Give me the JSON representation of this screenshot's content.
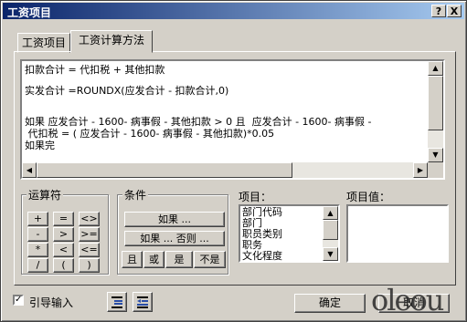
{
  "window": {
    "title": "工资项目",
    "help_glyph": "?",
    "close_glyph": "X"
  },
  "tabs": [
    {
      "label": "工资项目"
    },
    {
      "label": "工资计算方法"
    }
  ],
  "editor": {
    "lines": [
      "扣款合计 = 代扣税 + 其他扣款",
      "实发合计 =ROUNDX(应发合计 - 扣款合计,0)",
      "如果 应发合计 - 1600- 病事假 - 其他扣款 > 0 且  应发合计 - 1600- 病事假 -",
      " 代扣税 = ( 应发合计 - 1600- 病事假 - 其他扣款)*0.05",
      "如果完"
    ]
  },
  "operators": {
    "label": "运算符",
    "rows": [
      [
        "+",
        "=",
        "<>"
      ],
      [
        "-",
        ">",
        ">="
      ],
      [
        "*",
        "<",
        "<="
      ],
      [
        "/",
        "(",
        ")"
      ]
    ]
  },
  "conditions": {
    "label": "条件",
    "if_label": "如果 ...",
    "if_else_label": "如果 ... 否则 ...",
    "logic": [
      "且",
      "或",
      "是",
      "不是"
    ]
  },
  "items": {
    "label": "项目：",
    "list": [
      "部门代码",
      "部门",
      "职员类别",
      "职务",
      "文化程度"
    ]
  },
  "item_values": {
    "label": "项目值："
  },
  "footer": {
    "guide_input_label": "引导输入",
    "guide_input_checked": true,
    "ok_label": "确定",
    "cancel_label": "取消"
  },
  "watermark": "oleou"
}
